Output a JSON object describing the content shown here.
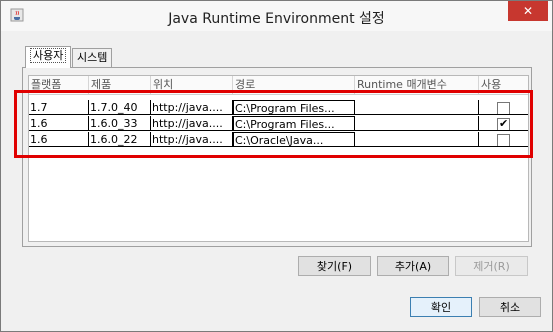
{
  "window": {
    "title": "Java Runtime Environment 설정",
    "close_label": "✕"
  },
  "tabs": [
    {
      "label": "사용자",
      "active": true
    },
    {
      "label": "시스템",
      "active": false
    }
  ],
  "table": {
    "headers": [
      "플랫폼",
      "제품",
      "위치",
      "경로",
      "Runtime 매개변수",
      "사용"
    ],
    "rows": [
      {
        "platform": "1.7",
        "product": "1.7.0_40",
        "location": "http://java....",
        "path": "C:\\Program Files...",
        "params": "",
        "enabled": false
      },
      {
        "platform": "1.6",
        "product": "1.6.0_33",
        "location": "http://java....",
        "path": "C:\\Program Files...",
        "params": "",
        "enabled": true
      },
      {
        "platform": "1.6",
        "product": "1.6.0_22",
        "location": "http://java....",
        "path": "C:\\Oracle\\Java...",
        "params": "",
        "enabled": false
      }
    ]
  },
  "buttons": {
    "find": "찾기(F)",
    "add": "추가(A)",
    "remove": "제거(R)",
    "ok": "확인",
    "cancel": "취소"
  },
  "colors": {
    "highlight": "#e00000",
    "close": "#c7372f"
  }
}
